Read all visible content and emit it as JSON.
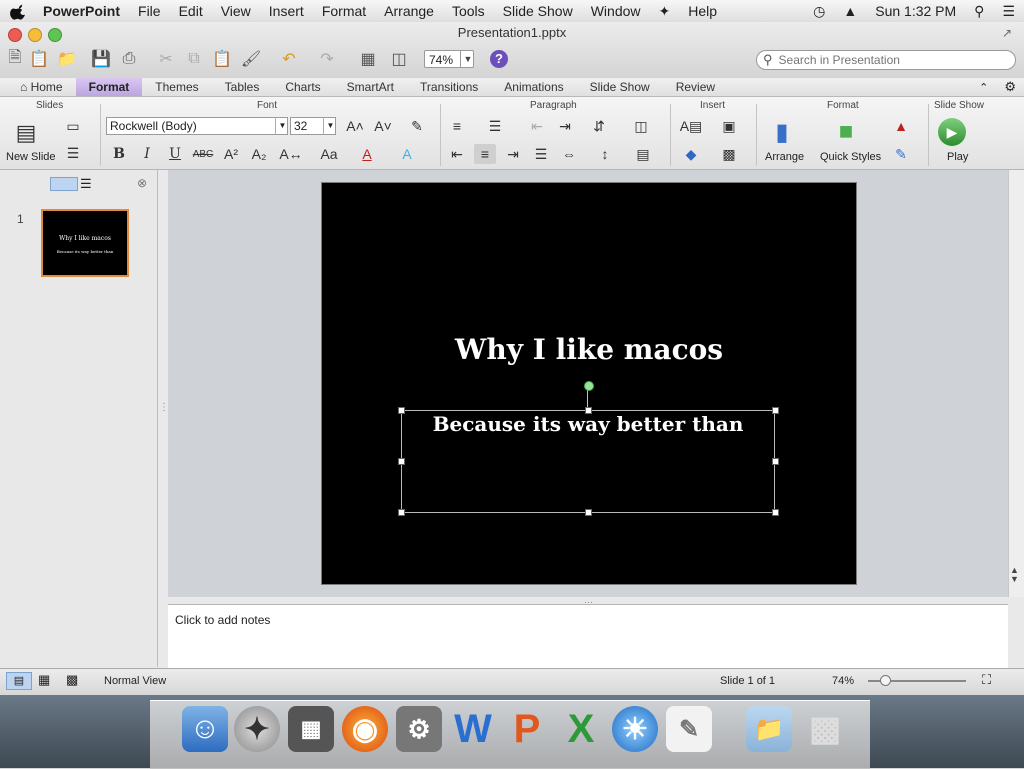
{
  "menubar": {
    "app_name": "PowerPoint",
    "items": [
      "File",
      "Edit",
      "View",
      "Insert",
      "Format",
      "Arrange",
      "Tools",
      "Slide Show",
      "Window",
      "Help"
    ],
    "clock": "Sun 1:32 PM"
  },
  "window": {
    "doc_title": "Presentation1.pptx",
    "zoom": "74%",
    "search_placeholder": "Search in Presentation"
  },
  "ribbon": {
    "tabs": [
      "Home",
      "Format",
      "Themes",
      "Tables",
      "Charts",
      "SmartArt",
      "Transitions",
      "Animations",
      "Slide Show",
      "Review"
    ],
    "active_tab": "Format",
    "groups": {
      "slides": "Slides",
      "font": "Font",
      "paragraph": "Paragraph",
      "insert": "Insert",
      "format": "Format",
      "slideshow": "Slide Show"
    },
    "new_slide_label": "New Slide",
    "font_name": "Rockwell (Body)",
    "font_size": "32",
    "arrange_label": "Arrange",
    "quick_styles_label": "Quick Styles",
    "play_label": "Play"
  },
  "thumbnails": {
    "slide_number": "1",
    "thumb_title": "Why I like macos",
    "thumb_sub": "Because its way better than"
  },
  "slide": {
    "title": "Why I like macos",
    "subtitle": "Because its way better than"
  },
  "notes": {
    "placeholder": "Click to add notes"
  },
  "statusbar": {
    "view_name": "Normal View",
    "slide_count": "Slide 1 of 1",
    "zoom": "74%"
  },
  "colors": {
    "active_tab": "#bba5e0",
    "thumb_border": "#e38a3a",
    "slide_bg": "#000000"
  }
}
